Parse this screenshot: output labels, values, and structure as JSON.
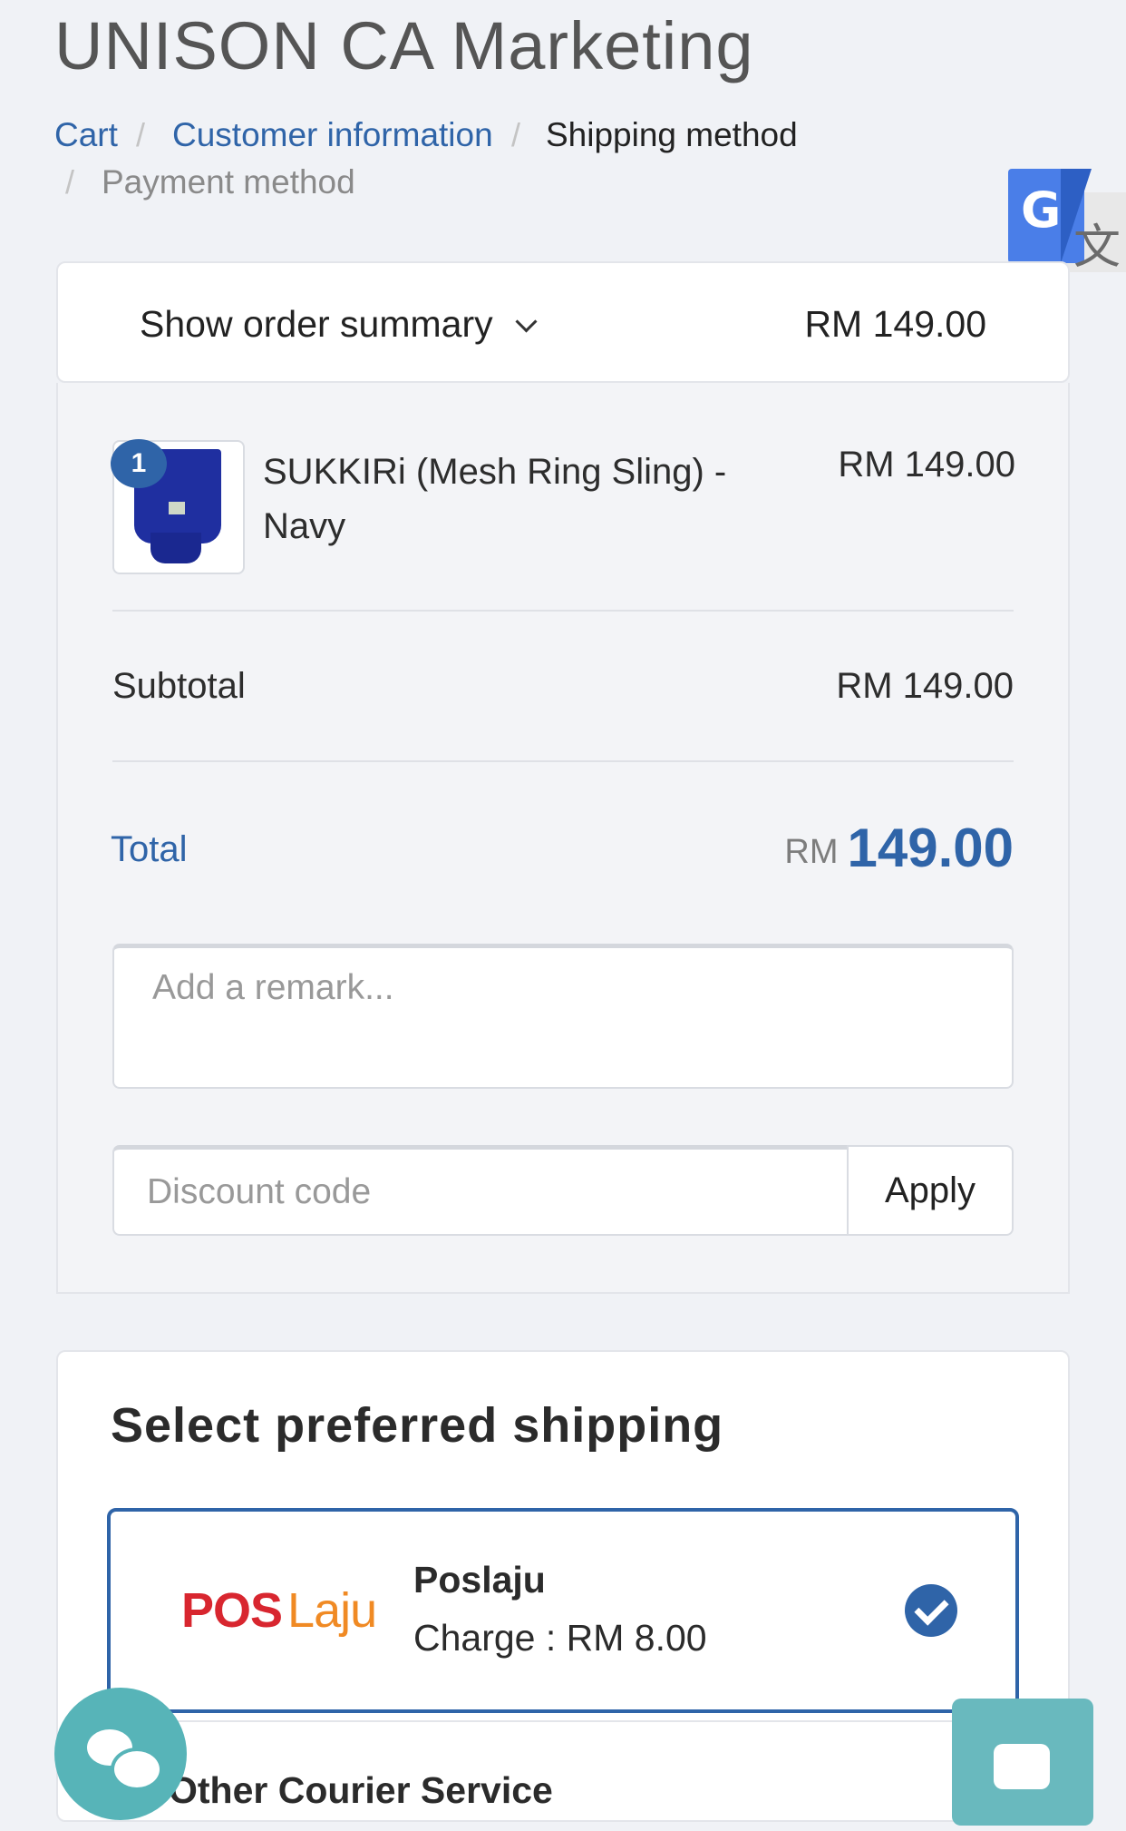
{
  "store": {
    "title": "UNISON CA Marketing"
  },
  "breadcrumb": {
    "items": [
      {
        "label": "Cart"
      },
      {
        "label": "Customer information"
      },
      {
        "label": "Shipping method"
      },
      {
        "label": "Payment method"
      }
    ],
    "separator": "/"
  },
  "translate_widget": {
    "icon": "google-translate-icon",
    "g_glyph": "G",
    "zh_glyph": "文"
  },
  "summary": {
    "toggle_label": "Show order summary",
    "total": "RM 149.00",
    "item": {
      "quantity": "1",
      "name": "SUKKIRi (Mesh Ring Sling) - Navy",
      "price": "RM 149.00"
    },
    "subtotal_label": "Subtotal",
    "subtotal_value": "RM 149.00",
    "total_label": "Total",
    "total_currency": "RM",
    "total_amount": "149.00",
    "remark_placeholder": "Add a remark...",
    "discount_placeholder": "Discount code",
    "apply_label": "Apply"
  },
  "shipping": {
    "title": "Select preferred shipping",
    "selected": {
      "logo_pos": "POS",
      "logo_laju": "Laju",
      "name": "Poslaju",
      "charge": "Charge : RM 8.00"
    },
    "other": {
      "name": "Other Courier Service"
    }
  },
  "colors": {
    "accent": "#2f64a8",
    "chat": "#57b4b8",
    "pos_red": "#d8262f",
    "laju_orange": "#f08a24"
  }
}
